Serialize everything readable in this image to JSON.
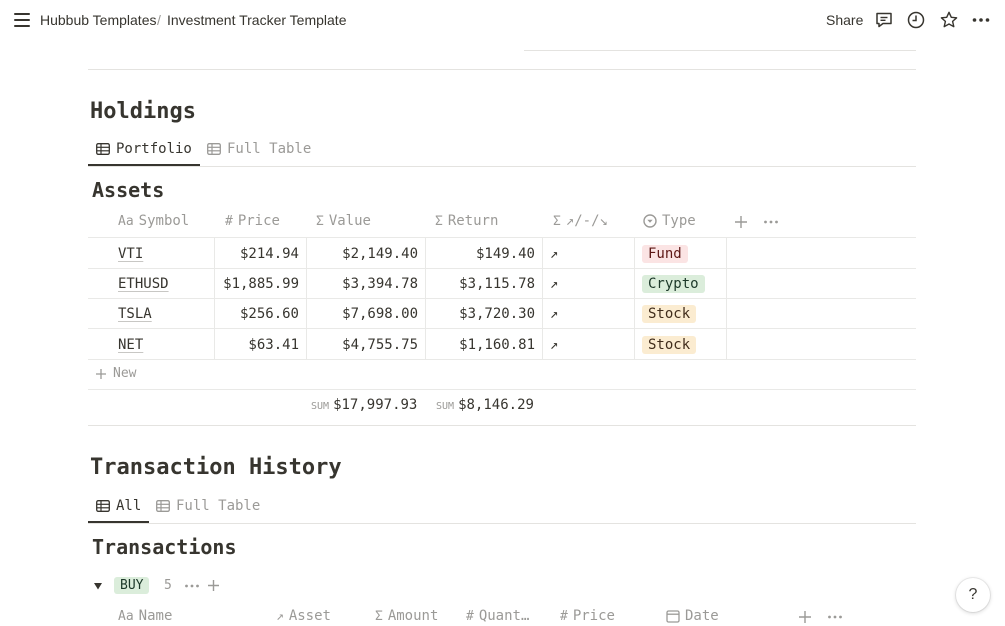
{
  "header": {
    "breadcrumb_workspace": "Hubbub Templates",
    "breadcrumb_separator": "/",
    "breadcrumb_page": "Investment Tracker Template",
    "share_label": "Share",
    "icons": [
      "menu-icon",
      "comment-icon",
      "history-icon",
      "star-icon",
      "more-icon"
    ]
  },
  "holdings": {
    "heading": "Holdings",
    "tabs": [
      {
        "label": "Portfolio",
        "active": true
      },
      {
        "label": "Full Table",
        "active": false
      }
    ],
    "table_title": "Assets",
    "columns": [
      {
        "icon": "Aa",
        "label": "Symbol"
      },
      {
        "icon": "#",
        "label": "Price"
      },
      {
        "icon": "Σ",
        "label": "Value"
      },
      {
        "icon": "Σ",
        "label": "Return"
      },
      {
        "icon": "Σ",
        "label": "↗/-/↘"
      },
      {
        "icon": "select-icon",
        "label": "Type"
      }
    ],
    "rows": [
      {
        "symbol": "VTI",
        "price": "$214.94",
        "value": "$2,149.40",
        "return": "$149.40",
        "trend": "↗",
        "type": "Fund"
      },
      {
        "symbol": "ETHUSD",
        "price": "$1,885.99",
        "value": "$3,394.78",
        "return": "$3,115.78",
        "trend": "↗",
        "type": "Crypto"
      },
      {
        "symbol": "TSLA",
        "price": "$256.60",
        "value": "$7,698.00",
        "return": "$3,720.30",
        "trend": "↗",
        "type": "Stock"
      },
      {
        "symbol": "NET",
        "price": "$63.41",
        "value": "$4,755.75",
        "return": "$1,160.81",
        "trend": "↗",
        "type": "Stock"
      }
    ],
    "new_label": "New",
    "sum_label": "SUM",
    "sum_value": "$17,997.93",
    "sum_return": "$8,146.29",
    "tag_colors": {
      "Fund": {
        "bg": "#fbe4e4",
        "fg": "#5d1715"
      },
      "Crypto": {
        "bg": "#dbeddb",
        "fg": "#1c3829"
      },
      "Stock": {
        "bg": "#fbecd1",
        "fg": "#402c1b"
      }
    }
  },
  "transactions": {
    "heading": "Transaction History",
    "tabs": [
      {
        "label": "All",
        "active": true
      },
      {
        "label": "Full Table",
        "active": false
      }
    ],
    "table_title": "Transactions",
    "group": {
      "label": "BUY",
      "count": "5",
      "bg": "#dbeddb",
      "fg": "#1c3829"
    },
    "columns": [
      {
        "icon": "Aa",
        "label": "Name"
      },
      {
        "icon": "↗",
        "label": "Asset"
      },
      {
        "icon": "Σ",
        "label": "Amount"
      },
      {
        "icon": "#",
        "label": "Quant…"
      },
      {
        "icon": "#",
        "label": "Price"
      },
      {
        "icon": "calendar-icon",
        "label": "Date"
      }
    ]
  },
  "help_label": "?"
}
